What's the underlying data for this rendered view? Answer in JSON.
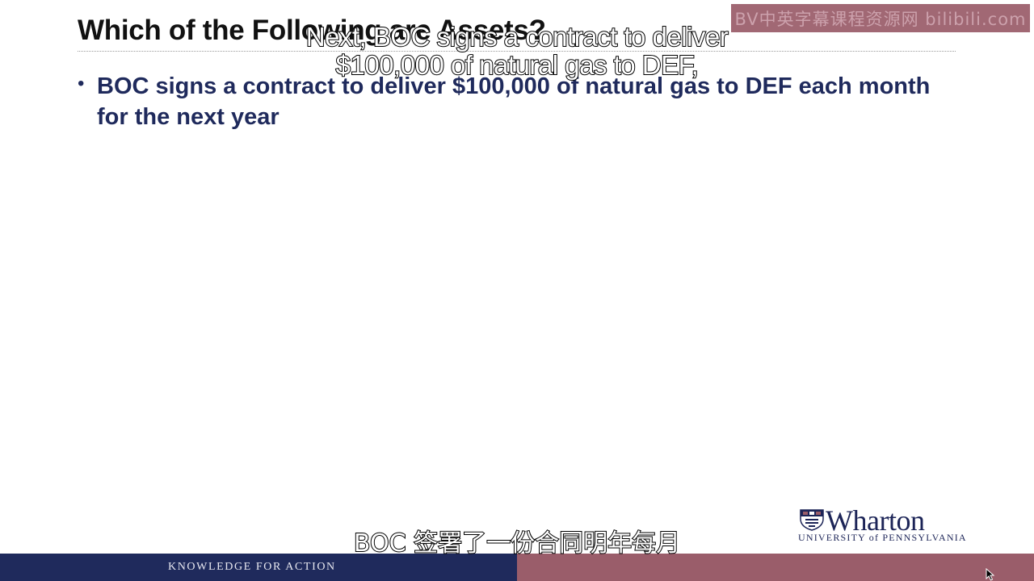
{
  "slide": {
    "title": "Which of the Following are Assets?",
    "bullets": [
      "BOC signs a contract to deliver $100,000 of natural gas to DEF each month for the next year"
    ]
  },
  "subtitles": {
    "english_line_1": "Next, BOC signs a contract to deliver",
    "english_line_2": "$100,000 of natural gas to DEF,",
    "chinese": "BOC 签署了一份合同明年每月"
  },
  "watermark": {
    "text": "BV中英字幕课程资源网 bilibili.com"
  },
  "logo": {
    "name": "Wharton",
    "subtitle": "UNIVERSITY of PENNSYLVANIA"
  },
  "footer": {
    "tagline": "KNOWLEDGE FOR ACTION"
  },
  "colors": {
    "navy": "#1f2a5c",
    "mauve": "#9a5d6a"
  }
}
